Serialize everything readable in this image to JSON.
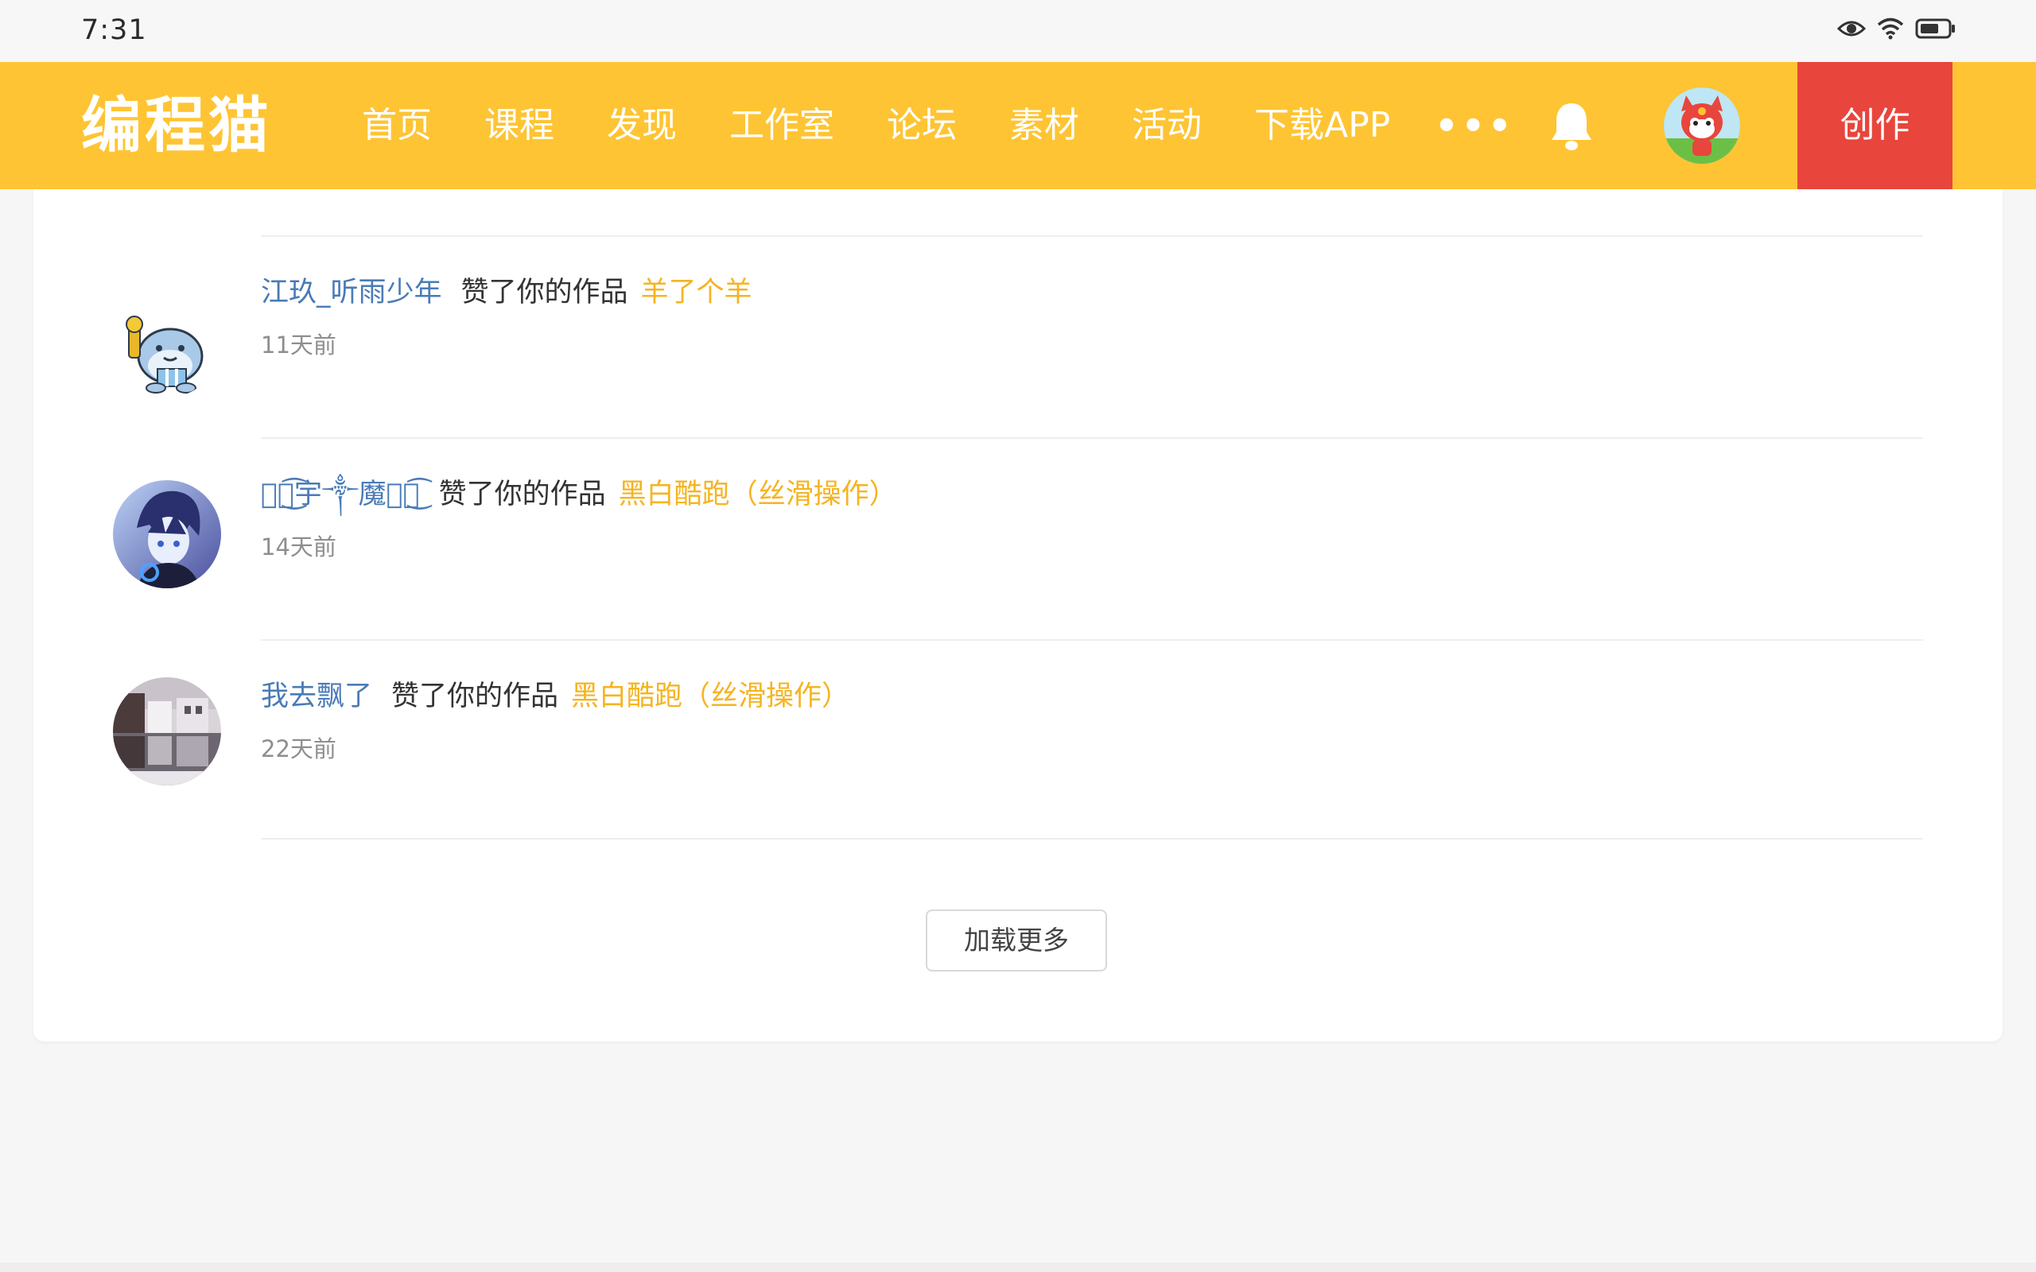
{
  "status_bar": {
    "time": "7:31",
    "icons": [
      "eye-icon",
      "wifi-icon",
      "battery-icon"
    ]
  },
  "nav": {
    "logo": "编程猫",
    "items": [
      "首页",
      "课程",
      "发现",
      "工作室",
      "论坛",
      "素材",
      "活动",
      "下载APP"
    ],
    "more": "•••",
    "create_label": "创作",
    "colors": {
      "bar": "#fec433",
      "create": "#e8453c"
    }
  },
  "notifications": [
    {
      "user": "江玖_听雨少年",
      "action": "赞了你的作品",
      "work": "羊了个羊",
      "time": "11天前"
    },
    {
      "user": "ৡৢ͜͡宇༒魔ৡৢ͜͡",
      "action": "赞了你的作品",
      "work": "黑白酷跑（丝滑操作）",
      "time": "14天前"
    },
    {
      "user": "我去飘了",
      "action": "赞了你的作品",
      "work": "黑白酷跑（丝滑操作）",
      "time": "22天前"
    }
  ],
  "load_more": "加载更多",
  "colors": {
    "username": "#4a7bb7",
    "work_link": "#f5b421",
    "timestamp": "#8e8e8e"
  }
}
